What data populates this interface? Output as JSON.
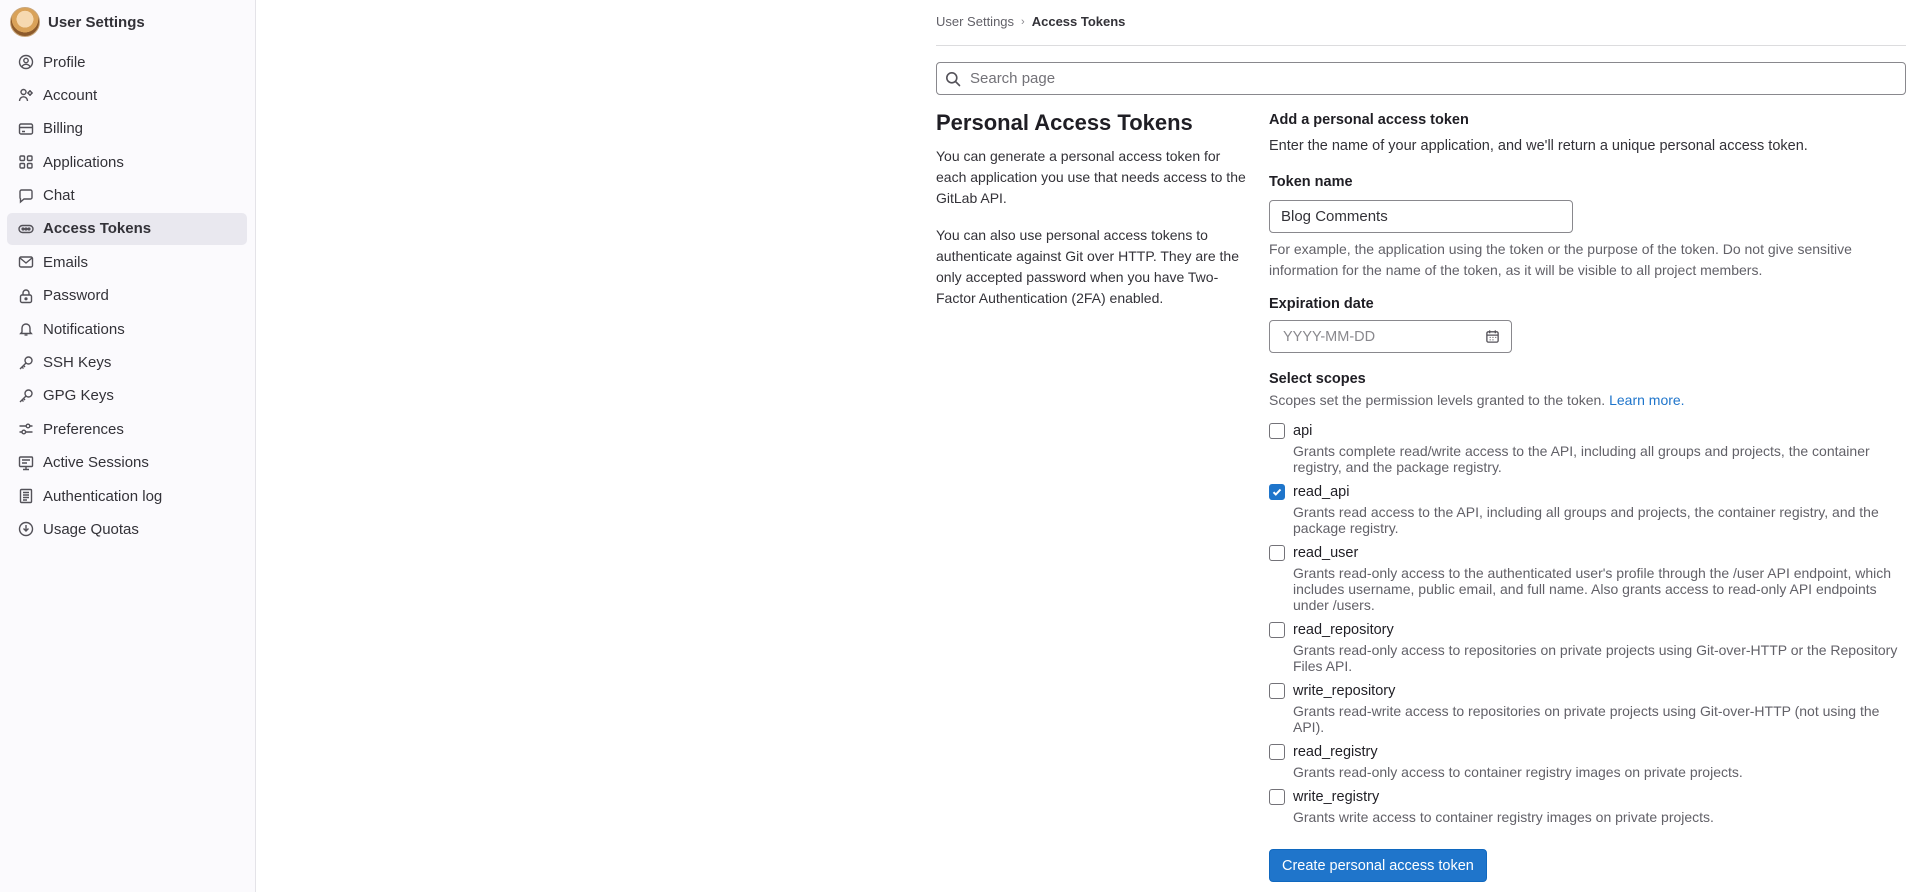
{
  "sidebar": {
    "title": "User Settings",
    "items": [
      {
        "label": "Profile",
        "icon": "user-circle-icon"
      },
      {
        "label": "Account",
        "icon": "account-icon"
      },
      {
        "label": "Billing",
        "icon": "credit-card-icon"
      },
      {
        "label": "Applications",
        "icon": "applications-icon"
      },
      {
        "label": "Chat",
        "icon": "chat-bubble-icon"
      },
      {
        "label": "Access Tokens",
        "icon": "token-icon",
        "active": true
      },
      {
        "label": "Emails",
        "icon": "mail-icon"
      },
      {
        "label": "Password",
        "icon": "lock-icon"
      },
      {
        "label": "Notifications",
        "icon": "bell-icon"
      },
      {
        "label": "SSH Keys",
        "icon": "key-icon"
      },
      {
        "label": "GPG Keys",
        "icon": "key-icon"
      },
      {
        "label": "Preferences",
        "icon": "preferences-icon"
      },
      {
        "label": "Active Sessions",
        "icon": "monitor-icon"
      },
      {
        "label": "Authentication log",
        "icon": "log-icon"
      },
      {
        "label": "Usage Quotas",
        "icon": "quota-icon"
      }
    ]
  },
  "breadcrumb": {
    "parent": "User Settings",
    "current": "Access Tokens",
    "separator": "›"
  },
  "search": {
    "placeholder": "Search page"
  },
  "intro": {
    "title": "Personal Access Tokens",
    "p1": "You can generate a personal access token for each application you use that needs access to the GitLab API.",
    "p2": "You can also use personal access tokens to authenticate against Git over HTTP. They are the only accepted password when you have Two-Factor Authentication (2FA) enabled."
  },
  "form": {
    "heading": "Add a personal access token",
    "subheading": "Enter the name of your application, and we'll return a unique personal access token.",
    "token_name_label": "Token name",
    "token_name_value": "Blog Comments",
    "token_name_help": "For example, the application using the token or the purpose of the token. Do not give sensitive information for the name of the token, as it will be visible to all project members.",
    "expiration_label": "Expiration date",
    "expiration_placeholder": "YYYY-MM-DD",
    "scopes_label": "Select scopes",
    "scopes_help": "Scopes set the permission levels granted to the token.",
    "scopes_link": "Learn more.",
    "submit_label": "Create personal access token"
  },
  "scopes": [
    {
      "name": "api",
      "checked": false,
      "desc": "Grants complete read/write access to the API, including all groups and projects, the container registry, and the package registry."
    },
    {
      "name": "read_api",
      "checked": true,
      "desc": "Grants read access to the API, including all groups and projects, the container registry, and the package registry."
    },
    {
      "name": "read_user",
      "checked": false,
      "desc": "Grants read-only access to the authenticated user's profile through the /user API endpoint, which includes username, public email, and full name. Also grants access to read-only API endpoints under /users."
    },
    {
      "name": "read_repository",
      "checked": false,
      "desc": "Grants read-only access to repositories on private projects using Git-over-HTTP or the Repository Files API."
    },
    {
      "name": "write_repository",
      "checked": false,
      "desc": "Grants read-write access to repositories on private projects using Git-over-HTTP (not using the API)."
    },
    {
      "name": "read_registry",
      "checked": false,
      "desc": "Grants read-only access to container registry images on private projects."
    },
    {
      "name": "write_registry",
      "checked": false,
      "desc": "Grants write access to container registry images on private projects."
    }
  ],
  "colors": {
    "accent": "#1f75cb",
    "sidebar_bg": "#fbfafd",
    "active_item_bg": "#e9e8ef"
  }
}
